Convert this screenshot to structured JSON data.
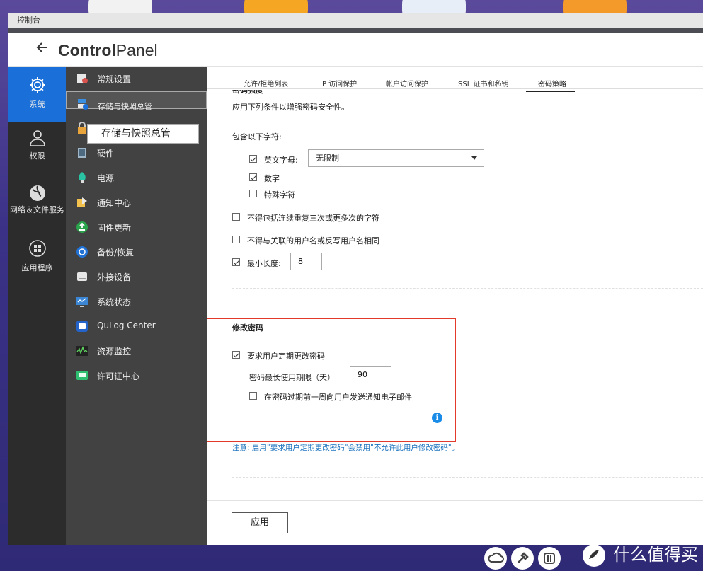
{
  "window": {
    "titlebar": "控制台",
    "title_bold": "Control",
    "title_rest": "Panel"
  },
  "categories": [
    {
      "label": "系统",
      "icon": "gear-icon",
      "active": true
    },
    {
      "label": "权限",
      "icon": "user-icon",
      "active": false
    },
    {
      "label": "网络＆文件服务",
      "icon": "globe-icon",
      "active": false
    },
    {
      "label": "应用程序",
      "icon": "apps-icon",
      "active": false
    }
  ],
  "subnav": [
    {
      "label": "常规设置",
      "icon": "general-settings-icon"
    },
    {
      "label": "存储与快照总管",
      "icon": "storage-icon",
      "selected": true
    },
    {
      "label": "安全",
      "icon": "lock-icon"
    },
    {
      "label": "硬件",
      "icon": "hardware-icon"
    },
    {
      "label": "电源",
      "icon": "power-icon"
    },
    {
      "label": "通知中心",
      "icon": "notification-icon"
    },
    {
      "label": "固件更新",
      "icon": "firmware-icon"
    },
    {
      "label": "备份/恢复",
      "icon": "backup-icon"
    },
    {
      "label": "外接设备",
      "icon": "external-device-icon"
    },
    {
      "label": "系统状态",
      "icon": "system-status-icon"
    },
    {
      "label": "QuLog Center",
      "icon": "qulog-icon"
    },
    {
      "label": "资源监控",
      "icon": "resource-monitor-icon"
    },
    {
      "label": "许可证中心",
      "icon": "license-icon"
    }
  ],
  "tooltip": "存储与快照总管",
  "tabs": [
    {
      "label": "允许/拒绝列表",
      "active": false
    },
    {
      "label": "IP 访问保护",
      "active": false
    },
    {
      "label": "帐户访问保护",
      "active": false
    },
    {
      "label": "SSL 证书和私钥",
      "active": false
    },
    {
      "label": "密码策略",
      "active": true
    }
  ],
  "password_strength": {
    "section_title_partial": "密码强度",
    "intro": "应用下列条件以增强密码安全性。",
    "include_label": "包含以下字符:",
    "letters_label": "英文字母:",
    "letters_checked": true,
    "letters_select_value": "无限制",
    "digits_label": "数字",
    "digits_checked": true,
    "special_label": "特殊字符",
    "special_checked": false,
    "no_repeat_label": "不得包括连续重复三次或更多次的字符",
    "no_repeat_checked": false,
    "no_username_label": "不得与关联的用户名或反写用户名相同",
    "no_username_checked": false,
    "min_length_label": "最小长度:",
    "min_length_checked": true,
    "min_length_value": "8"
  },
  "change_password": {
    "title": "修改密码",
    "require_label": "要求用户定期更改密码",
    "require_checked": true,
    "max_age_label": "密码最长使用期限（天）",
    "max_age_value": "90",
    "notify_label": "在密码过期前一周向用户发送通知电子邮件",
    "notify_checked": false,
    "info_glyph": "i"
  },
  "note": "注意: 启用\"要求用户定期更改密码\"会禁用\"不允许此用户修改密码\"。",
  "apply_label": "应用",
  "watermark": "什么值得买"
}
